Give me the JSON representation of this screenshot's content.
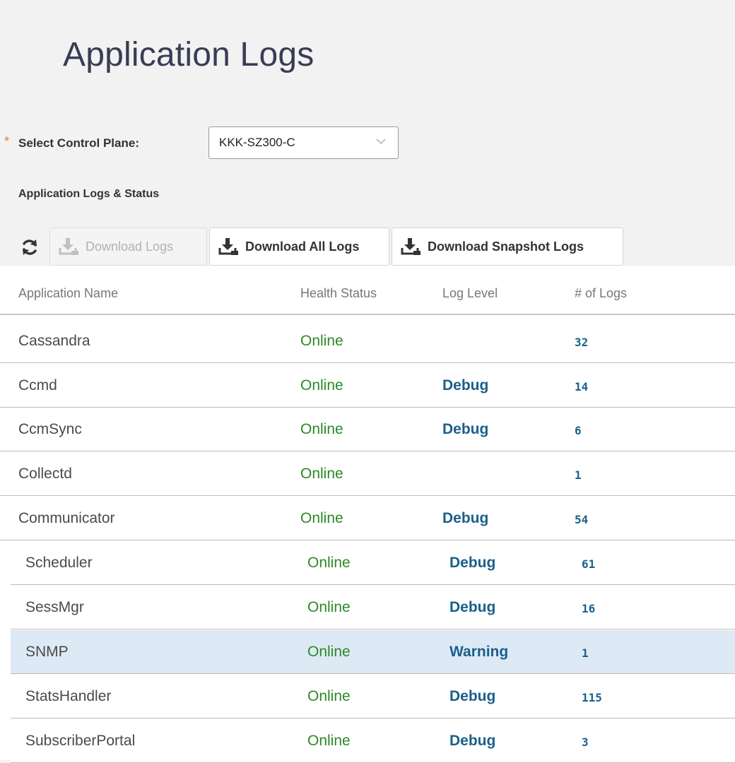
{
  "page": {
    "title": "Application Logs"
  },
  "control_plane": {
    "required_marker": "*",
    "label": "Select Control Plane:",
    "selected_value": "KKK-SZ300-C"
  },
  "section": {
    "title": "Application Logs & Status"
  },
  "toolbar": {
    "download_logs_label": "Download Logs",
    "download_all_logs_label": "Download All Logs",
    "download_snapshot_logs_label": "Download Snapshot Logs"
  },
  "table": {
    "columns": {
      "name": "Application Name",
      "health": "Health Status",
      "level": "Log Level",
      "count": "# of Logs"
    },
    "rows": [
      {
        "name": "Cassandra",
        "health": "Online",
        "level": "",
        "count": "32"
      },
      {
        "name": "Ccmd",
        "health": "Online",
        "level": "Debug",
        "count": "14"
      },
      {
        "name": "CcmSync",
        "health": "Online",
        "level": "Debug",
        "count": "6"
      },
      {
        "name": "Collectd",
        "health": "Online",
        "level": "",
        "count": "1"
      },
      {
        "name": "Communicator",
        "health": "Online",
        "level": "Debug",
        "count": "54"
      },
      {
        "name": "Scheduler",
        "health": "Online",
        "level": "Debug",
        "count": "61"
      },
      {
        "name": "SessMgr",
        "health": "Online",
        "level": "Debug",
        "count": "16"
      },
      {
        "name": "SNMP",
        "health": "Online",
        "level": "Warning",
        "count": "1"
      },
      {
        "name": "StatsHandler",
        "health": "Online",
        "level": "Debug",
        "count": "115"
      },
      {
        "name": "SubscriberPortal",
        "health": "Online",
        "level": "Debug",
        "count": "3"
      }
    ]
  },
  "colors": {
    "online": "#2b8a26",
    "level_and_count": "#1b5f8a",
    "selected_row": "#ddeaf5",
    "required": "#e77d2b"
  }
}
